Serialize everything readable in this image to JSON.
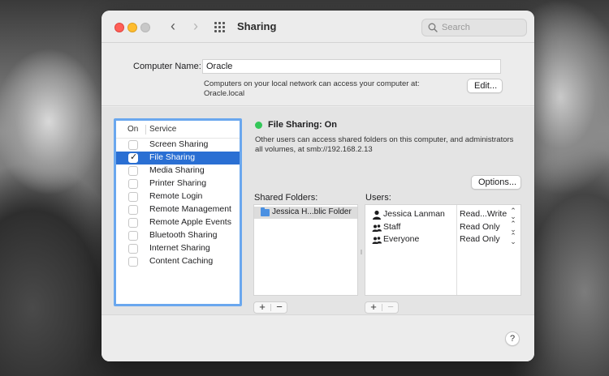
{
  "window": {
    "title": "Sharing"
  },
  "search": {
    "placeholder": "Search"
  },
  "computer_name": {
    "label": "Computer Name:",
    "value": "Oracle",
    "help_line1": "Computers on your local network can access your computer at:",
    "help_line2": "Oracle.local",
    "edit_label": "Edit..."
  },
  "services": {
    "header_on": "On",
    "header_service": "Service",
    "items": [
      {
        "label": "Screen Sharing",
        "checked": false,
        "selected": false
      },
      {
        "label": "File Sharing",
        "checked": true,
        "selected": true
      },
      {
        "label": "Media Sharing",
        "checked": false,
        "selected": false
      },
      {
        "label": "Printer Sharing",
        "checked": false,
        "selected": false
      },
      {
        "label": "Remote Login",
        "checked": false,
        "selected": false
      },
      {
        "label": "Remote Management",
        "checked": false,
        "selected": false
      },
      {
        "label": "Remote Apple Events",
        "checked": false,
        "selected": false
      },
      {
        "label": "Bluetooth Sharing",
        "checked": false,
        "selected": false
      },
      {
        "label": "Internet Sharing",
        "checked": false,
        "selected": false
      },
      {
        "label": "Content Caching",
        "checked": false,
        "selected": false
      }
    ]
  },
  "detail": {
    "status_title": "File Sharing: On",
    "status_color": "#34c759",
    "desc_line1": "Other users can access shared folders on this computer, and administrators",
    "desc_line2": "all volumes, at smb://192.168.2.13",
    "options_label": "Options...",
    "shared_folders_label": "Shared Folders:",
    "users_label": "Users:",
    "folders": [
      "Jessica H...blic Folder"
    ],
    "users": [
      {
        "name": "Jessica Lanman",
        "permission": "Read...Write",
        "icon": "single-user-icon"
      },
      {
        "name": "Staff",
        "permission": "Read Only",
        "icon": "group-icon"
      },
      {
        "name": "Everyone",
        "permission": "Read Only",
        "icon": "group-icon"
      }
    ],
    "plus": "+",
    "minus": "−"
  },
  "help": {
    "label": "?"
  },
  "colors": {
    "accent": "#2a6fd3",
    "focus_ring": "#6aa7ee"
  }
}
